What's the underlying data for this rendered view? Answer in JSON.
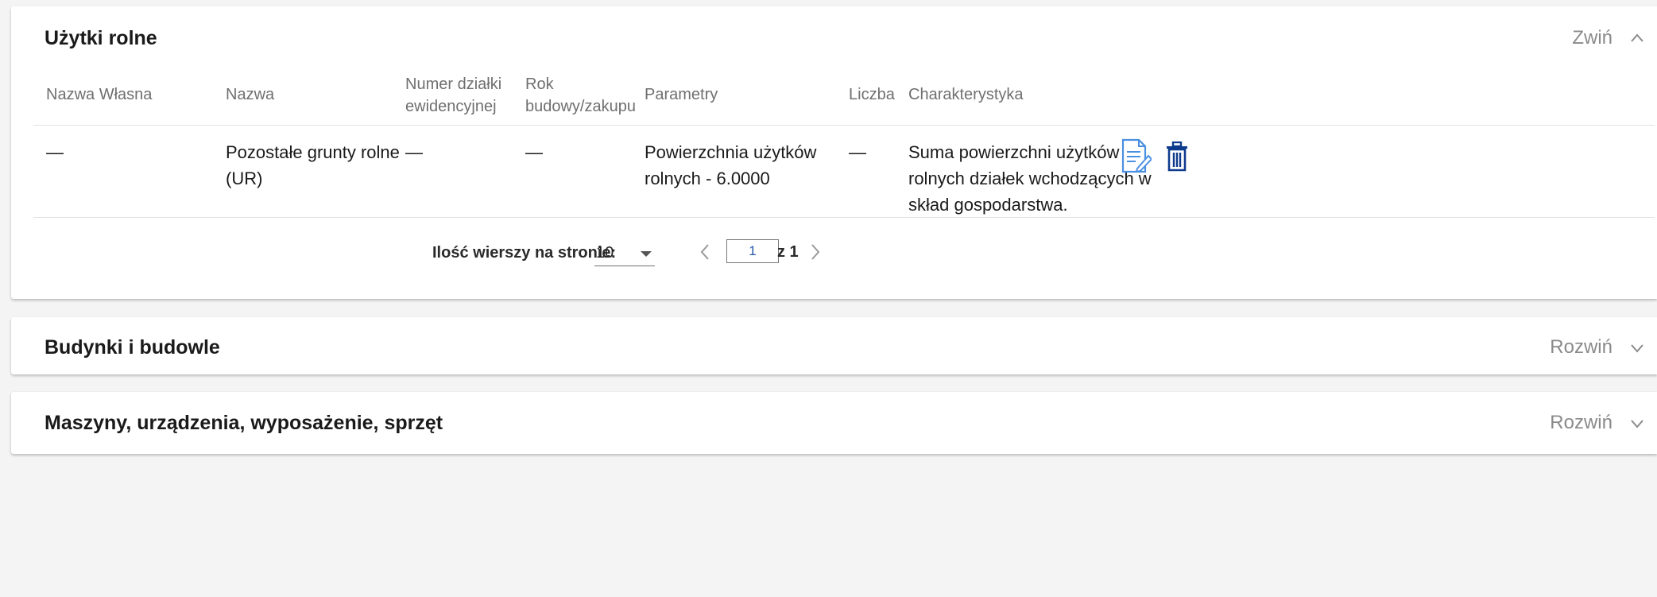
{
  "sections": [
    {
      "title": "Użytki rolne",
      "toggle_label": "Zwiń",
      "expanded": true
    },
    {
      "title": "Budynki i budowle",
      "toggle_label": "Rozwiń",
      "expanded": false
    },
    {
      "title": "Maszyny, urządzenia, wyposażenie, sprzęt",
      "toggle_label": "Rozwiń",
      "expanded": false
    }
  ],
  "table": {
    "headers": {
      "nazwa_wlasna": "Nazwa Własna",
      "nazwa": "Nazwa",
      "numer_line1": "Numer działki",
      "numer_line2": "ewidencyjnej",
      "rok_line1": "Rok",
      "rok_line2": "budowy/zakupu",
      "parametry": "Parametry",
      "liczba": "Liczba",
      "charakterystyka": "Charakterystyka"
    },
    "rows": [
      {
        "nazwa_wlasna": "—",
        "nazwa_line1": "Pozostałe grunty rolne",
        "nazwa_line2": "(UR)",
        "numer": "—",
        "rok": "—",
        "parametry_line1": "Powierzchnia użytków",
        "parametry_line2": "rolnych - 6.0000",
        "liczba": "—",
        "char_line1": "Suma powierzchni użytków",
        "char_line2": "rolnych działek wchodzących w",
        "char_line3": "skład gospodarstwa."
      }
    ]
  },
  "pagination": {
    "rows_label": "Ilość wierszy na stronie:",
    "rows_per_page": "10",
    "current_page": "1",
    "total_pages_label": "z 1"
  },
  "icons": {
    "edit": "edit-document-icon",
    "delete": "trash-icon",
    "collapse": "chevron-up-icon",
    "expand": "chevron-down-icon",
    "prev": "chevron-left-icon",
    "next": "chevron-right-icon",
    "dropdown": "caret-down-icon"
  },
  "colors": {
    "accent_blue": "#1f5fbf",
    "edit_icon_blue": "#4a90e2",
    "muted_text": "#8a8a8a"
  }
}
